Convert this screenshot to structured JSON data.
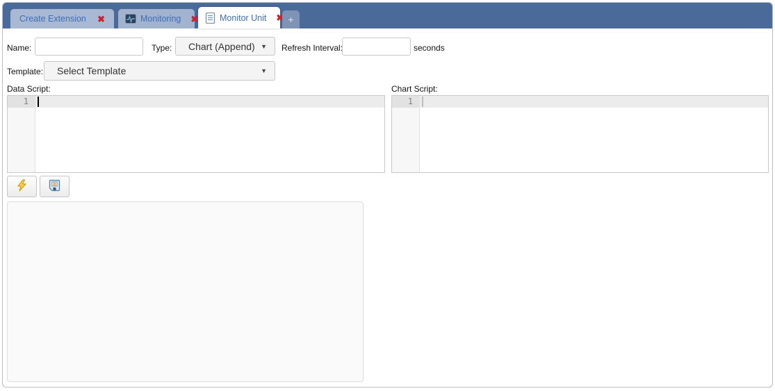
{
  "tabs": [
    {
      "label": "Create Extension",
      "close_glyph": "✖"
    },
    {
      "label": "Monitoring",
      "close_glyph": "✖",
      "icon": "monitoring-icon"
    },
    {
      "label": "Monitor Unit",
      "close_glyph": "✖",
      "icon": "document-icon",
      "state": "active"
    },
    {
      "label": "+"
    }
  ],
  "form": {
    "name_label": "Name:",
    "name_value": "",
    "type_label": "Type:",
    "type_value": "Chart (Append)",
    "refresh_label": "Refresh Interval:",
    "refresh_value": "",
    "refresh_unit": "seconds",
    "template_label": "Template:",
    "template_value": "Select Template"
  },
  "editors": {
    "data_script": {
      "label": "Data Script:",
      "line_number": "1",
      "content": ""
    },
    "chart_script": {
      "label": "Chart Script:",
      "line_number": "1",
      "content": ""
    }
  },
  "toolbar": {
    "run_button_icon": "lightning-icon",
    "save_button_icon": "floppy-disk-icon"
  },
  "dropdown_arrow_glyph": "▼",
  "colors": {
    "tab_bar": "#4a6b99",
    "inactive_tab": "#a9b9d3",
    "tab_text": "#3e6db5",
    "close_icon": "#c9232f",
    "lightning_yellow": "#ffd84d",
    "floppy_blue": "#4a86b8",
    "floppy_orange": "#e8952f"
  }
}
